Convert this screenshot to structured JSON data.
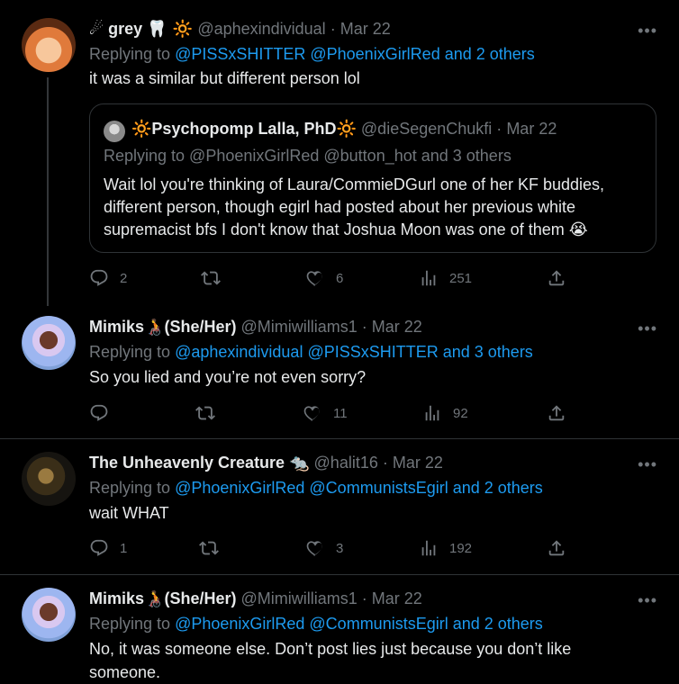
{
  "tweets": [
    {
      "name": "grey",
      "name_prefix_emoji": "☄",
      "name_suffix_emoji": "🦷 🔆",
      "handle": "@aphexindividual",
      "date": "Mar 22",
      "replying_prefix": "Replying to",
      "mentions": "@PISSxSHITTER @PhoenixGirlRed and 2 others",
      "text": "it was a similar but different person lol",
      "quote": {
        "name": "Psychopomp Lalla, PhD",
        "name_emoji": "🔆",
        "handle": "@dieSegenChukfi",
        "date": "Mar 22",
        "replying_line": "Replying to @PhoenixGirlRed @button_hot and 3 others",
        "text": "Wait lol you're thinking of Laura/CommieDGurl one of her KF buddies, different person, though egirl had posted about her previous white supremacist bfs I don't know that Joshua Moon was one of them 😭"
      },
      "replies": "2",
      "retweets": "",
      "likes": "6",
      "views": "251"
    },
    {
      "name": "Mimiks",
      "name_emoji": "🧑‍🦽",
      "pronouns": "(She/Her)",
      "handle": "@Mimiwilliams1",
      "date": "Mar 22",
      "replying_prefix": "Replying to",
      "mentions": "@aphexindividual @PISSxSHITTER and 3 others",
      "text": "So you lied and you’re not even sorry?",
      "replies": "",
      "retweets": "",
      "likes": "11",
      "views": "92"
    },
    {
      "name": "The Unheavenly Creature",
      "name_emoji": "🐀",
      "handle": "@halit16",
      "date": "Mar 22",
      "replying_prefix": "Replying to",
      "mentions": "@PhoenixGirlRed @CommunistsEgirl and 2 others",
      "text": "wait WHAT",
      "replies": "1",
      "retweets": "",
      "likes": "3",
      "views": "192"
    },
    {
      "name": "Mimiks",
      "name_emoji": "🧑‍🦽",
      "pronouns": "(She/Her)",
      "handle": "@Mimiwilliams1",
      "date": "Mar 22",
      "replying_prefix": "Replying to",
      "mentions": "@PhoenixGirlRed @CommunistsEgirl and 2 others",
      "text": "No, it was someone else. Don’t post lies just because you don’t like someone."
    }
  ],
  "more_label": "•••",
  "separator": "·",
  "colors": {
    "background": "#000000",
    "text": "#e7e9ea",
    "muted": "#71767b",
    "link": "#1d9bf0",
    "border": "#2f3336"
  }
}
